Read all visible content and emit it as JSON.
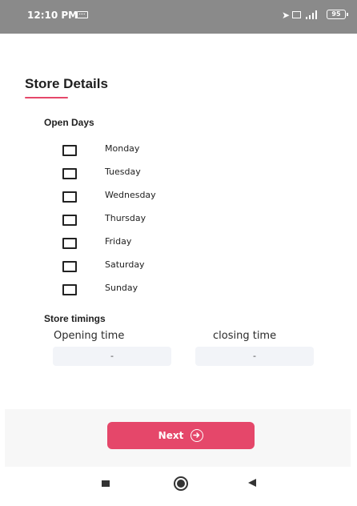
{
  "status_bar": {
    "time": "12:10 PM",
    "battery": "95",
    "icons": [
      "message-icon",
      "navigation-icon",
      "volume-icon",
      "signal-icon",
      "battery-icon"
    ]
  },
  "page": {
    "title": "Store Details",
    "open_days_label": "Open Days",
    "days": [
      {
        "label": "Monday",
        "checked": false
      },
      {
        "label": "Tuesday",
        "checked": false
      },
      {
        "label": "Wednesday",
        "checked": false
      },
      {
        "label": "Thursday",
        "checked": false
      },
      {
        "label": "Friday",
        "checked": false
      },
      {
        "label": "Saturday",
        "checked": false
      },
      {
        "label": "Sunday",
        "checked": false
      }
    ],
    "timings_label": "Store timings",
    "opening_time_label": "Opening time",
    "opening_time_value": "-",
    "closing_time_label": "closing time",
    "closing_time_value": "-"
  },
  "footer": {
    "next_label": "Next"
  },
  "colors": {
    "accent": "#e5476a",
    "status_bar": "#8a8a8a",
    "field_bg": "#f2f4f8"
  }
}
